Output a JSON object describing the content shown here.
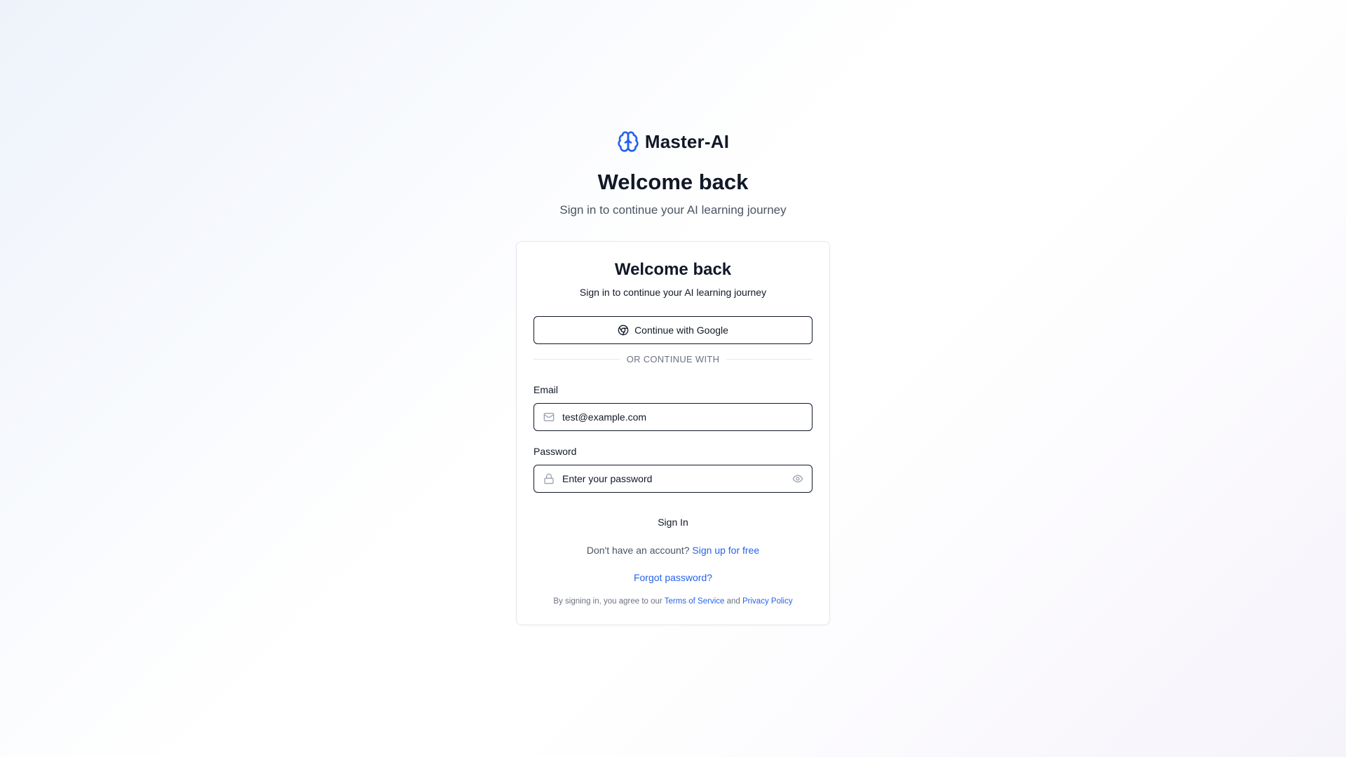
{
  "brand": {
    "name": "Master-AI",
    "icon": "brain-icon",
    "accent": "#2563eb"
  },
  "hero": {
    "title": "Welcome back",
    "subtitle": "Sign in to continue your AI learning journey"
  },
  "card": {
    "title": "Welcome back",
    "subtitle": "Sign in to continue your AI learning journey",
    "google_button": {
      "label": "Continue with Google",
      "icon": "chrome-icon"
    },
    "divider_text": "OR CONTINUE WITH",
    "email": {
      "label": "Email",
      "value": "test@example.com",
      "icon": "mail-icon"
    },
    "password": {
      "label": "Password",
      "value": "",
      "placeholder": "Enter your password",
      "icon": "lock-icon",
      "toggle_icon": "eye-icon"
    },
    "signin_label": "Sign In",
    "signup": {
      "prompt": "Don't have an account?",
      "link": "Sign up for free"
    },
    "forgot_link": "Forgot password?",
    "legal": {
      "prefix": "By signing in, you agree to our",
      "terms": "Terms of Service",
      "conjunction": "and",
      "privacy": "Privacy Policy"
    }
  },
  "colors": {
    "text_primary": "#111827",
    "text_muted": "#4b5563",
    "link": "#2563eb",
    "border": "#e5e7eb"
  }
}
